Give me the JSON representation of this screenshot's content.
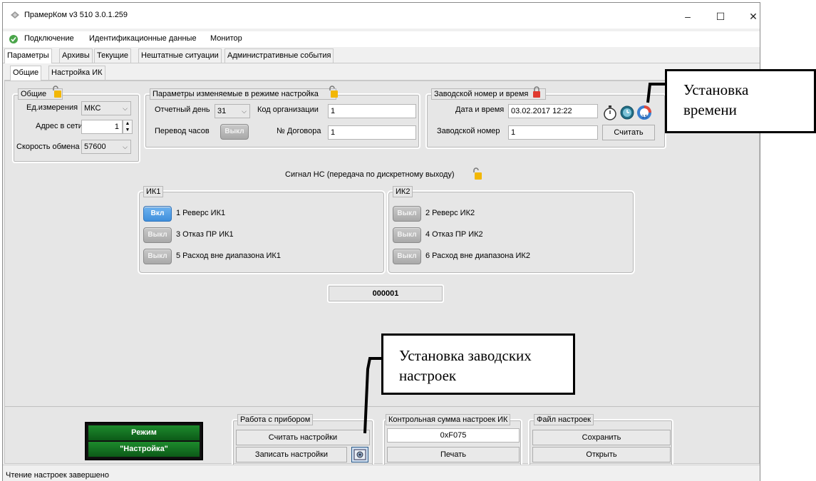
{
  "window": {
    "title": "ПрамерКом v3 510 3.0.1.259"
  },
  "menu": [
    "Подключение",
    "Идентификационные данные",
    "Монитор"
  ],
  "main_tabs": [
    "Параметры",
    "Архивы",
    "Текущие",
    "Нештатные ситуации",
    "Административные события"
  ],
  "sub_tabs": [
    "Общие",
    "Настройка ИК"
  ],
  "general": {
    "title": "Общие",
    "unit_label": "Ед.измерения",
    "unit_value": "МКС",
    "address_label": "Адрес в сети",
    "address_value": "1",
    "speed_label": "Скорость обмена",
    "speed_value": "57600"
  },
  "setup_params": {
    "title": "Параметры изменяемые в режиме настройка",
    "report_day_label": "Отчетный день",
    "report_day_value": "31",
    "org_code_label": "Код организации",
    "org_code_value": "1",
    "clock_label": "Перевод часов",
    "clock_toggle": "Выкл",
    "contract_label": "№ Договора",
    "contract_value": "1"
  },
  "factory": {
    "title": "Заводской номер и время",
    "datetime_label": "Дата и время",
    "datetime_value": "03.02.2017 12:22",
    "serial_label": "Заводской номер",
    "serial_value": "1",
    "read_button": "Считать",
    "icons": [
      "stopwatch-icon",
      "clock-icon",
      "calendar-clock-icon"
    ]
  },
  "signal": {
    "title": "Сигнал НС (передача по дискретному выходу)",
    "ik1": {
      "title": "ИК1",
      "rows": [
        {
          "state": "Вкл",
          "on": true,
          "label": "1  Реверс ИК1"
        },
        {
          "state": "Выкл",
          "on": false,
          "label": "3  Отказ ПР ИК1"
        },
        {
          "state": "Выкл",
          "on": false,
          "label": "5  Расход вне диапазона ИК1"
        }
      ]
    },
    "ik2": {
      "title": "ИК2",
      "rows": [
        {
          "state": "Выкл",
          "on": false,
          "label": "2  Реверс ИК2"
        },
        {
          "state": "Выкл",
          "on": false,
          "label": "4  Отказ ПР ИК2"
        },
        {
          "state": "Выкл",
          "on": false,
          "label": "6  Расход вне диапазона ИК2"
        }
      ]
    },
    "code": "000001"
  },
  "mode": {
    "line1": "Режим",
    "line2": "\"Настройка\""
  },
  "device": {
    "title": "Работа с прибором",
    "read_button": "Считать настройки",
    "write_button": "Записать настройки"
  },
  "checksum": {
    "title": "Контрольная сумма настроек ИК",
    "value": "0xF075",
    "print_button": "Печать"
  },
  "settings_file": {
    "title": "Файл настроек",
    "save_button": "Сохранить",
    "open_button": "Открыть"
  },
  "status_text": "Чтение настроек завершено",
  "callouts": {
    "time": "Установка времени",
    "factory": "Установка заводских настроек"
  }
}
